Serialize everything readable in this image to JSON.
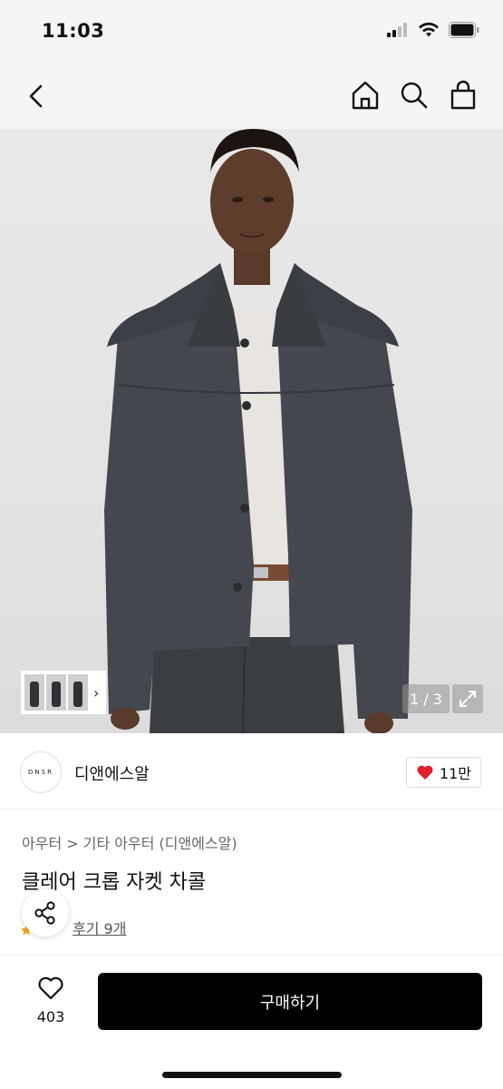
{
  "status": {
    "time": "11:03"
  },
  "hero": {
    "page_indicator": "1 / 3",
    "image_count": 3
  },
  "brand": {
    "logo_text": "DNSR",
    "name": "디앤에스알",
    "likes": "11만"
  },
  "product": {
    "category": "아우터  >  기타 아우터 (디앤에스알)",
    "title": "클레어 크롭 자켓 차콜",
    "review": "후기 9개"
  },
  "bottom": {
    "wish_count": "403",
    "buy_label": "구매하기"
  },
  "colors": {
    "accent": "#000000",
    "heart": "#e0202c"
  }
}
